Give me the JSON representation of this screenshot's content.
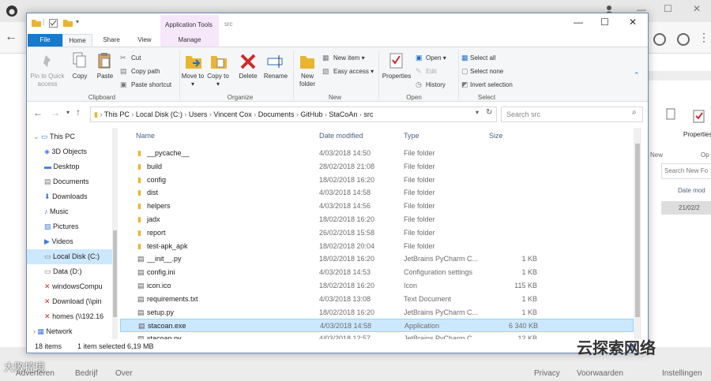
{
  "explorer": {
    "title_path": "src",
    "context_tab": "Application Tools",
    "context_subtab": "Manage",
    "tabs": [
      "File",
      "Home",
      "Share",
      "View"
    ],
    "ribbon": {
      "pin": "Pin to Quick access",
      "copy": "Copy",
      "paste": "Paste",
      "cut": "Cut",
      "copy_path": "Copy path",
      "paste_shortcut": "Paste shortcut",
      "move_to": "Move to ▾",
      "copy_to": "Copy to ▾",
      "delete": "Delete",
      "rename": "Rename",
      "new_folder": "New folder",
      "new_item": "New item ▾",
      "easy_access": "Easy access ▾",
      "properties": "Properties",
      "open": "Open ▾",
      "edit": "Edit",
      "history": "History",
      "select_all": "Select all",
      "select_none": "Select none",
      "invert": "Invert selection",
      "groups": [
        "Clipboard",
        "Organize",
        "New",
        "Open",
        "Select"
      ]
    },
    "address": {
      "segments": [
        "This PC",
        "Local Disk (C:)",
        "Users",
        "Vincent Cox",
        "Documents",
        "GitHub",
        "StaCoAn",
        "src"
      ],
      "search_placeholder": "Search src"
    },
    "nav_items": [
      "This PC",
      "3D Objects",
      "Desktop",
      "Documents",
      "Downloads",
      "Music",
      "Pictures",
      "Videos",
      "Local Disk (C:)",
      "Data (D:)",
      "windowsCompu",
      "Download (\\\\pin",
      "homes (\\\\192.16",
      "Network"
    ],
    "columns": [
      "Name",
      "Date modified",
      "Type",
      "Size"
    ],
    "files": [
      {
        "name": "__pycache__",
        "date": "4/03/2018 14:50",
        "type": "File folder",
        "size": ""
      },
      {
        "name": "build",
        "date": "28/02/2018 21:08",
        "type": "File folder",
        "size": ""
      },
      {
        "name": "config",
        "date": "18/02/2018 16:20",
        "type": "File folder",
        "size": ""
      },
      {
        "name": "dist",
        "date": "4/03/2018 14:58",
        "type": "File folder",
        "size": ""
      },
      {
        "name": "helpers",
        "date": "4/03/2018 14:56",
        "type": "File folder",
        "size": ""
      },
      {
        "name": "jadx",
        "date": "18/02/2018 16:20",
        "type": "File folder",
        "size": ""
      },
      {
        "name": "report",
        "date": "26/02/2018 15:58",
        "type": "File folder",
        "size": ""
      },
      {
        "name": "test-apk_apk",
        "date": "18/02/2018 20:04",
        "type": "File folder",
        "size": ""
      },
      {
        "name": "__init__.py",
        "date": "18/02/2018 16:20",
        "type": "JetBrains PyCharm C...",
        "size": "1 KB"
      },
      {
        "name": "config.ini",
        "date": "4/03/2018 14:53",
        "type": "Configuration settings",
        "size": "1 KB"
      },
      {
        "name": "icon.ico",
        "date": "18/02/2018 16:20",
        "type": "Icon",
        "size": "115 KB"
      },
      {
        "name": "requirements.txt",
        "date": "4/03/2018 13:08",
        "type": "Text Document",
        "size": "1 KB"
      },
      {
        "name": "setup.py",
        "date": "18/02/2018 16:20",
        "type": "JetBrains PyCharm C...",
        "size": "1 KB"
      },
      {
        "name": "stacoan.exe",
        "date": "4/03/2018 14:58",
        "type": "Application",
        "size": "6 340 KB"
      },
      {
        "name": "stacoan.py",
        "date": "4/03/2018 12:57",
        "type": "JetBrains PyCharm C...",
        "size": "12 KB"
      }
    ],
    "status": {
      "count": "18 items",
      "selected": "1 item selected  6,19 MB"
    }
  },
  "back_explorer": {
    "properties": "Properties",
    "new": "New",
    "open": "Op",
    "search": "Search New Fo",
    "date_col": "Date mod",
    "date_val": "21/02/2"
  },
  "browser_bottom": {
    "left": [
      "Adverteren",
      "Bedrijf",
      "Over"
    ],
    "right": [
      "Privacy",
      "Voorwaarden",
      "Instellingen"
    ]
  },
  "watermarks": {
    "right": "云探索网络",
    "left": "大败控境"
  }
}
